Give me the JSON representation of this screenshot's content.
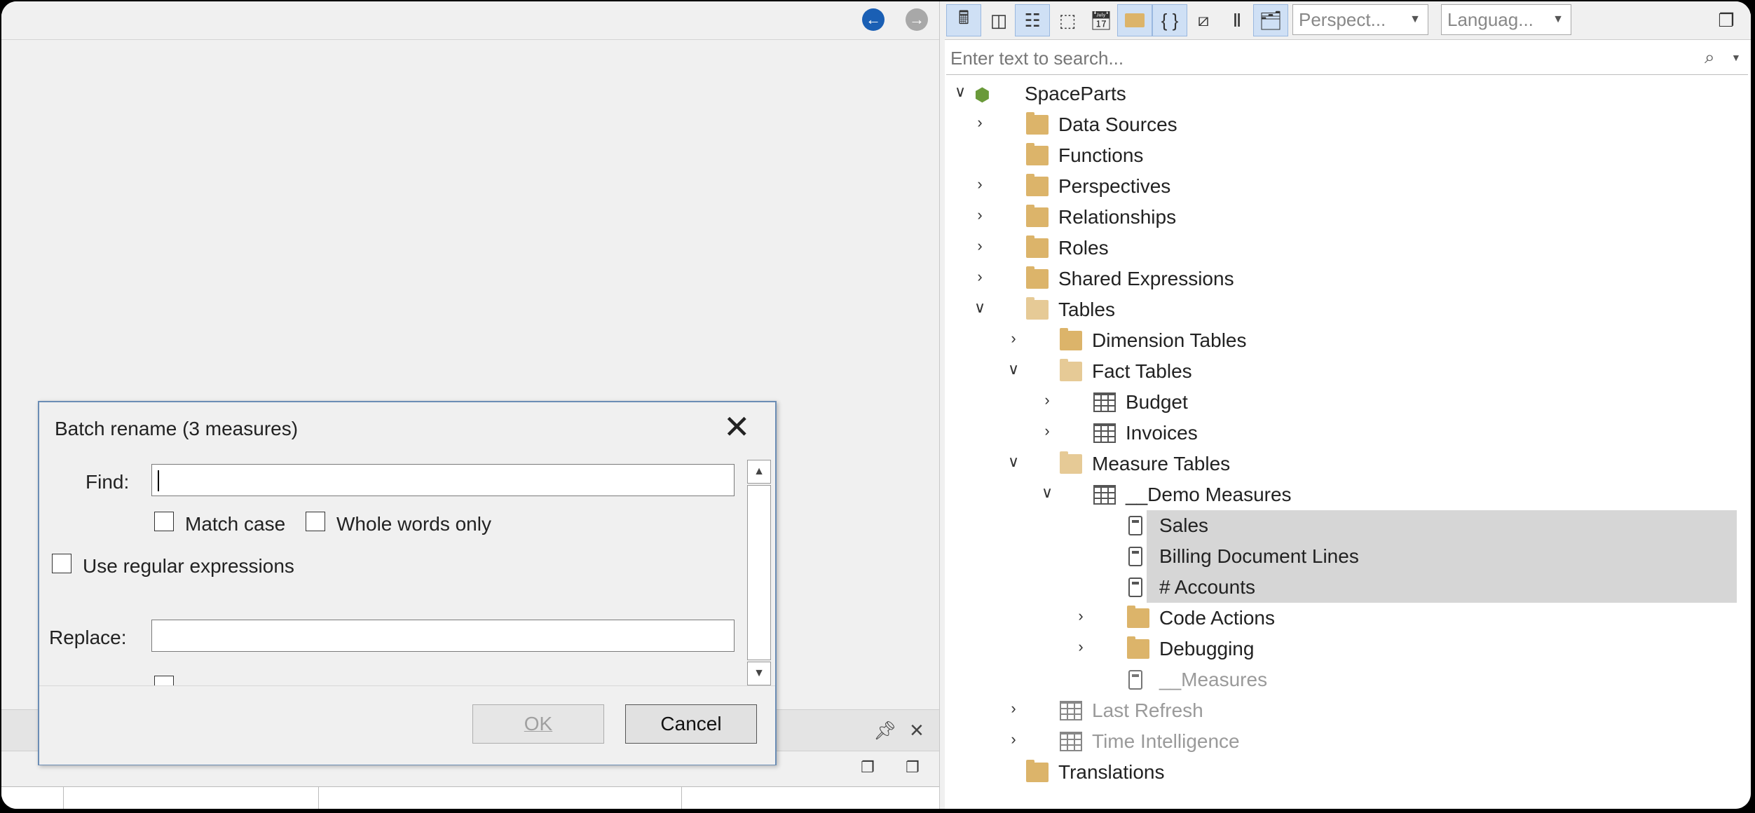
{
  "dialog": {
    "title": "Batch rename (3 measures)",
    "find_label": "Find:",
    "find_value": "",
    "match_case": "Match case",
    "whole_words": "Whole words only",
    "use_regex": "Use regular expressions",
    "replace_label": "Replace:",
    "replace_value": "",
    "ok": "OK",
    "cancel": "Cancel"
  },
  "toolbar": {
    "perspective": "Perspect...",
    "language": "Languag..."
  },
  "search": {
    "placeholder": "Enter text to search..."
  },
  "tree": {
    "root": "SpaceParts",
    "data_sources": "Data Sources",
    "functions": "Functions",
    "perspectives": "Perspectives",
    "relationships": "Relationships",
    "roles": "Roles",
    "shared_expressions": "Shared Expressions",
    "tables": "Tables",
    "dimension_tables": "Dimension Tables",
    "fact_tables": "Fact Tables",
    "budget": "Budget",
    "invoices": "Invoices",
    "measure_tables": "Measure Tables",
    "demo_measures": "__Demo Measures",
    "sales": "Sales",
    "billing_lines": "Billing Document Lines",
    "accounts": "# Accounts",
    "code_actions": "Code Actions",
    "debugging": "Debugging",
    "measures": "__Measures",
    "last_refresh": "Last Refresh",
    "time_intelligence": "Time Intelligence",
    "translations": "Translations"
  },
  "colors": {
    "accent": "#1a5fb4",
    "folder": "#dcb46a",
    "selection": "#d6d6d6"
  }
}
